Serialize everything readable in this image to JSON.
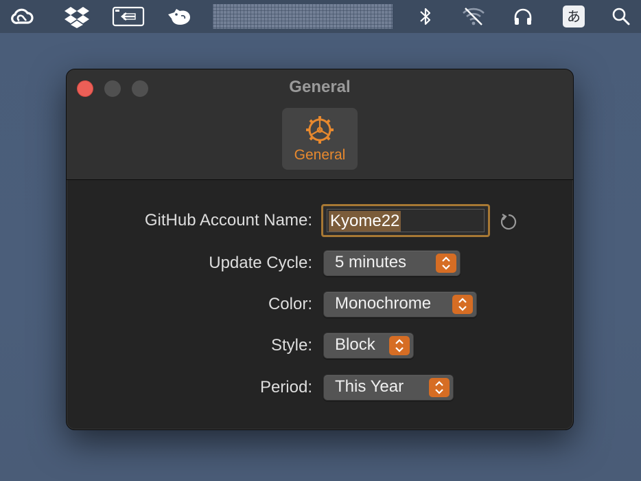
{
  "menubar": {
    "icons": [
      "creative-cloud-icon",
      "dropbox-icon",
      "screen-share-icon",
      "bird-app-icon",
      "contribution-graph-icon",
      "bluetooth-icon",
      "wifi-off-icon",
      "headphones-icon",
      "input-method-icon",
      "search-icon"
    ],
    "input_method_label": "あ"
  },
  "window": {
    "title": "General",
    "toolbar": {
      "tab_label": "General"
    }
  },
  "form": {
    "account_label": "GitHub Account Name:",
    "account_value": "Kyome22",
    "update_label": "Update Cycle:",
    "update_value": "5 minutes",
    "color_label": "Color:",
    "color_value": "Monochrome",
    "style_label": "Style:",
    "style_value": "Block",
    "period_label": "Period:",
    "period_value": "This Year"
  },
  "colors": {
    "accent": "#e8892e",
    "close_button": "#ec5f57",
    "popup_chevron": "#d66d24",
    "focus_ring": "#a77834"
  }
}
